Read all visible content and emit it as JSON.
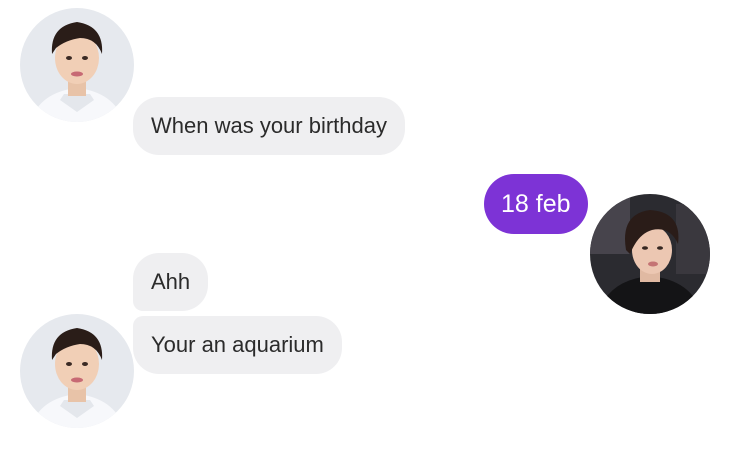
{
  "conversation": {
    "messages": [
      {
        "sender": "contact",
        "text": "When was your birthday"
      },
      {
        "sender": "me",
        "text": "18 feb"
      },
      {
        "sender": "contact",
        "text": "Ahh"
      },
      {
        "sender": "contact",
        "text": "Your an aquarium"
      }
    ]
  },
  "colors": {
    "incoming_bubble": "#efeff1",
    "outgoing_bubble": "#7d33d6",
    "incoming_text": "#2b2b2b",
    "outgoing_text": "#ffffff"
  }
}
